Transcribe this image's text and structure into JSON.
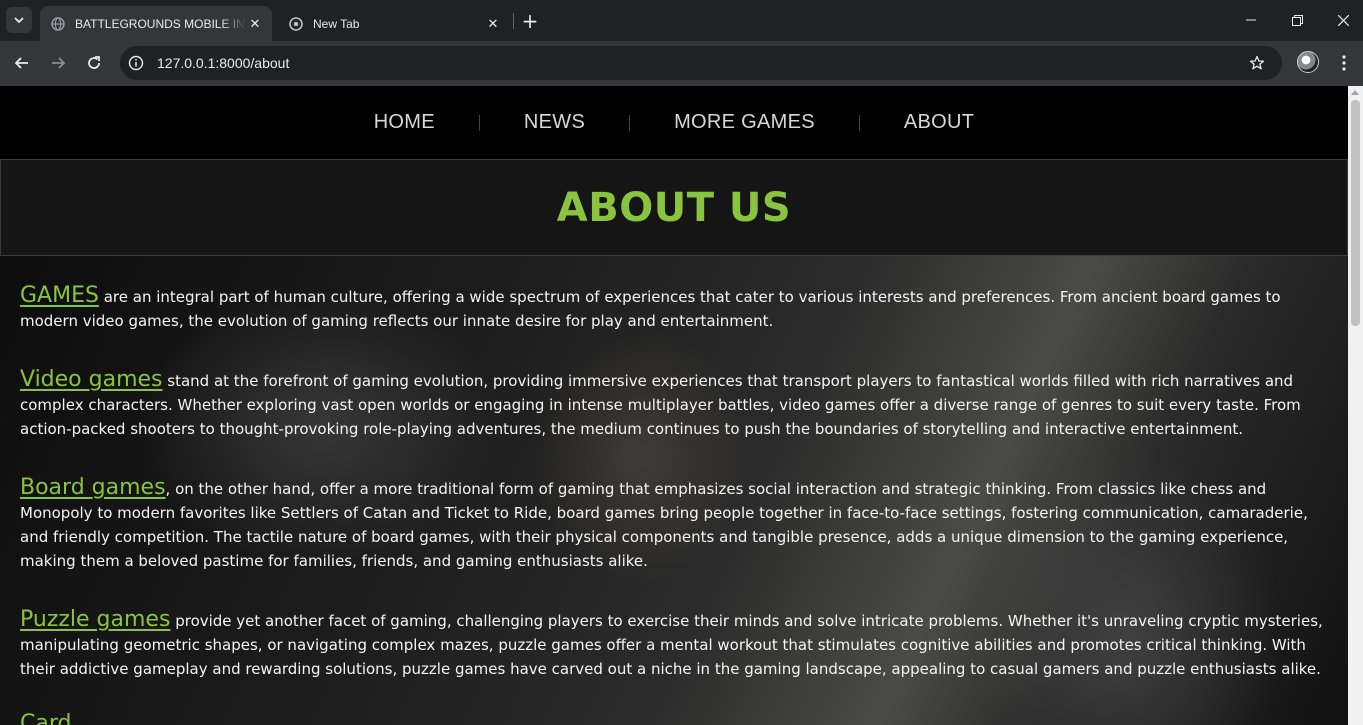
{
  "browser": {
    "tabs": [
      {
        "title": "BATTLEGROUNDS MOBILE INDIA",
        "active": true
      },
      {
        "title": "New Tab",
        "active": false
      }
    ],
    "url": "127.0.0.1:8000/about"
  },
  "site": {
    "nav": [
      "HOME",
      "NEWS",
      "MORE GAMES",
      "ABOUT"
    ],
    "heading": "ABOUT US",
    "accent_color": "#8ac43f",
    "paragraphs": [
      {
        "lead": "GAMES",
        "text": " are an integral part of human culture, offering a wide spectrum of experiences that cater to various interests and preferences. From ancient board games to modern video games, the evolution of gaming reflects our innate desire for play and entertainment."
      },
      {
        "lead": "Video games",
        "text": " stand at the forefront of gaming evolution, providing immersive experiences that transport players to fantastical worlds filled with rich narratives and complex characters. Whether exploring vast open worlds or engaging in intense multiplayer battles, video games offer a diverse range of genres to suit every taste. From action-packed shooters to thought-provoking role-playing adventures, the medium continues to push the boundaries of storytelling and interactive entertainment."
      },
      {
        "lead": "Board games",
        "text": ", on the other hand, offer a more traditional form of gaming that emphasizes social interaction and strategic thinking. From classics like chess and Monopoly to modern favorites like Settlers of Catan and Ticket to Ride, board games bring people together in face-to-face settings, fostering communication, camaraderie, and friendly competition. The tactile nature of board games, with their physical components and tangible presence, adds a unique dimension to the gaming experience, making them a beloved pastime for families, friends, and gaming enthusiasts alike."
      },
      {
        "lead": "Puzzle games",
        "text": " provide yet another facet of gaming, challenging players to exercise their minds and solve intricate problems. Whether it's unraveling cryptic mysteries, manipulating geometric shapes, or navigating complex mazes, puzzle games offer a mental workout that stimulates cognitive abilities and promotes critical thinking. With their addictive gameplay and rewarding solutions, puzzle games have carved out a niche in the gaming landscape, appealing to casual gamers and puzzle enthusiasts alike."
      },
      {
        "lead": "Card",
        "text": ""
      }
    ]
  }
}
